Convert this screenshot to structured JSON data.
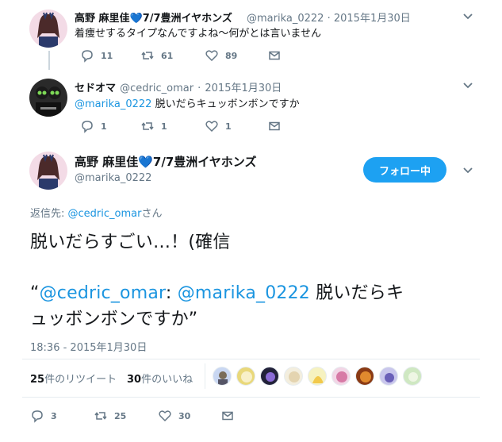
{
  "tweet1": {
    "name": "高野 麻里佳💙7/7豊洲イヤホンズ",
    "handle": "@marika_0222",
    "sep": "·",
    "date": "2015年1月30日",
    "text": "着痩せするタイプなんですよね〜何がとは言いません",
    "replies": "11",
    "retweets": "61",
    "likes": "89"
  },
  "tweet2": {
    "name": "セドオマ",
    "handle": "@cedric_omar",
    "sep": "·",
    "date": "2015年1月30日",
    "mention": "@marika_0222",
    "text": " 脱いだらキュッボンボンですか",
    "replies": "1",
    "retweets": "1",
    "likes": "1"
  },
  "main": {
    "name": "高野 麻里佳💙7/7豊洲イヤホンズ",
    "handle": "@marika_0222",
    "follow_label": "フォロー中",
    "reply_to_prefix": "返信先: ",
    "reply_to_handle": "@cedric_omar",
    "reply_to_suffix": "さん",
    "line1": "脱いだらすごい…！(確信",
    "quote_open": "“",
    "quote_user": "@cedric_omar",
    "quote_colon": ": ",
    "quote_mention": "@marika_0222",
    "quote_rest1": " 脱いだらキ",
    "quote_rest2": "ュッボンボンですか”",
    "timestamp": "18:36 - 2015年1月30日",
    "retweet_count": "25",
    "retweet_label": "件のリツイート",
    "like_count": "30",
    "like_label": "件のいいね",
    "replies": "3",
    "retweets": "25",
    "likes": "30"
  },
  "colors": {
    "accent": "#1da1f2",
    "link": "#1b95e0",
    "muted": "#657786"
  }
}
